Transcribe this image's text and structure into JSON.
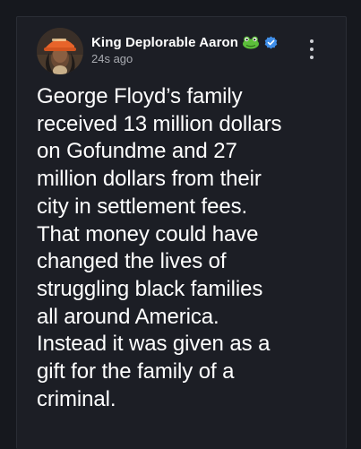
{
  "post": {
    "author_name": "King Deplorable Aaron",
    "timestamp": "24s ago",
    "badges": [
      "frog-emoji-icon",
      "verified-check-icon"
    ],
    "text": "George Floyd’s family\nreceived 13 million dollars\non Gofundme and 27\nmillion dollars from their\ncity in settlement fees.\nThat money could have\nchanged the lives of\nstruggling black families\nall around America.\nInstead it was given as a\ngift for the family of a\ncriminal."
  },
  "colors": {
    "background": "#16181e",
    "card": "#1c1e25",
    "text": "#ffffff",
    "muted": "#a8aab0",
    "verified": "#3f8ee8",
    "frog": "#5cbf3a"
  },
  "icons": {
    "menu": "more-vertical-icon"
  }
}
